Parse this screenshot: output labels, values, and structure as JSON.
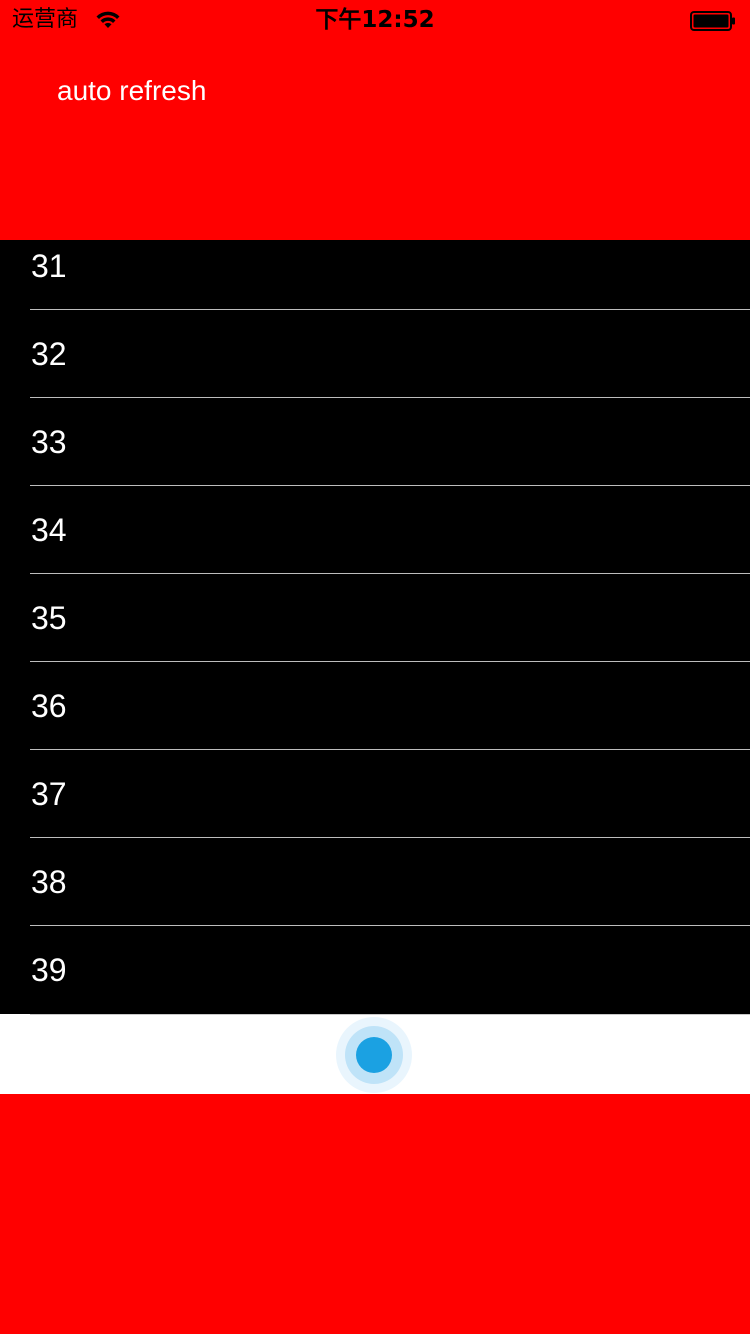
{
  "status_bar": {
    "carrier": "运营商",
    "time": "下午12:52",
    "wifi_icon": "wifi-icon",
    "battery_icon": "battery-full-icon"
  },
  "header": {
    "title": "auto refresh",
    "background_color": "#ff0000",
    "text_color": "#ffffff"
  },
  "table": {
    "background_color": "#000000",
    "rows": [
      {
        "label": "31"
      },
      {
        "label": "32"
      },
      {
        "label": "33"
      },
      {
        "label": "34"
      },
      {
        "label": "35"
      },
      {
        "label": "36"
      },
      {
        "label": "37"
      },
      {
        "label": "38"
      },
      {
        "label": "39"
      }
    ]
  },
  "footer_loader": {
    "icon": "loading-spinner-icon",
    "accent_color": "#1ba1e2",
    "background_color": "#ffffff"
  },
  "page": {
    "background_color": "#ff0000"
  }
}
